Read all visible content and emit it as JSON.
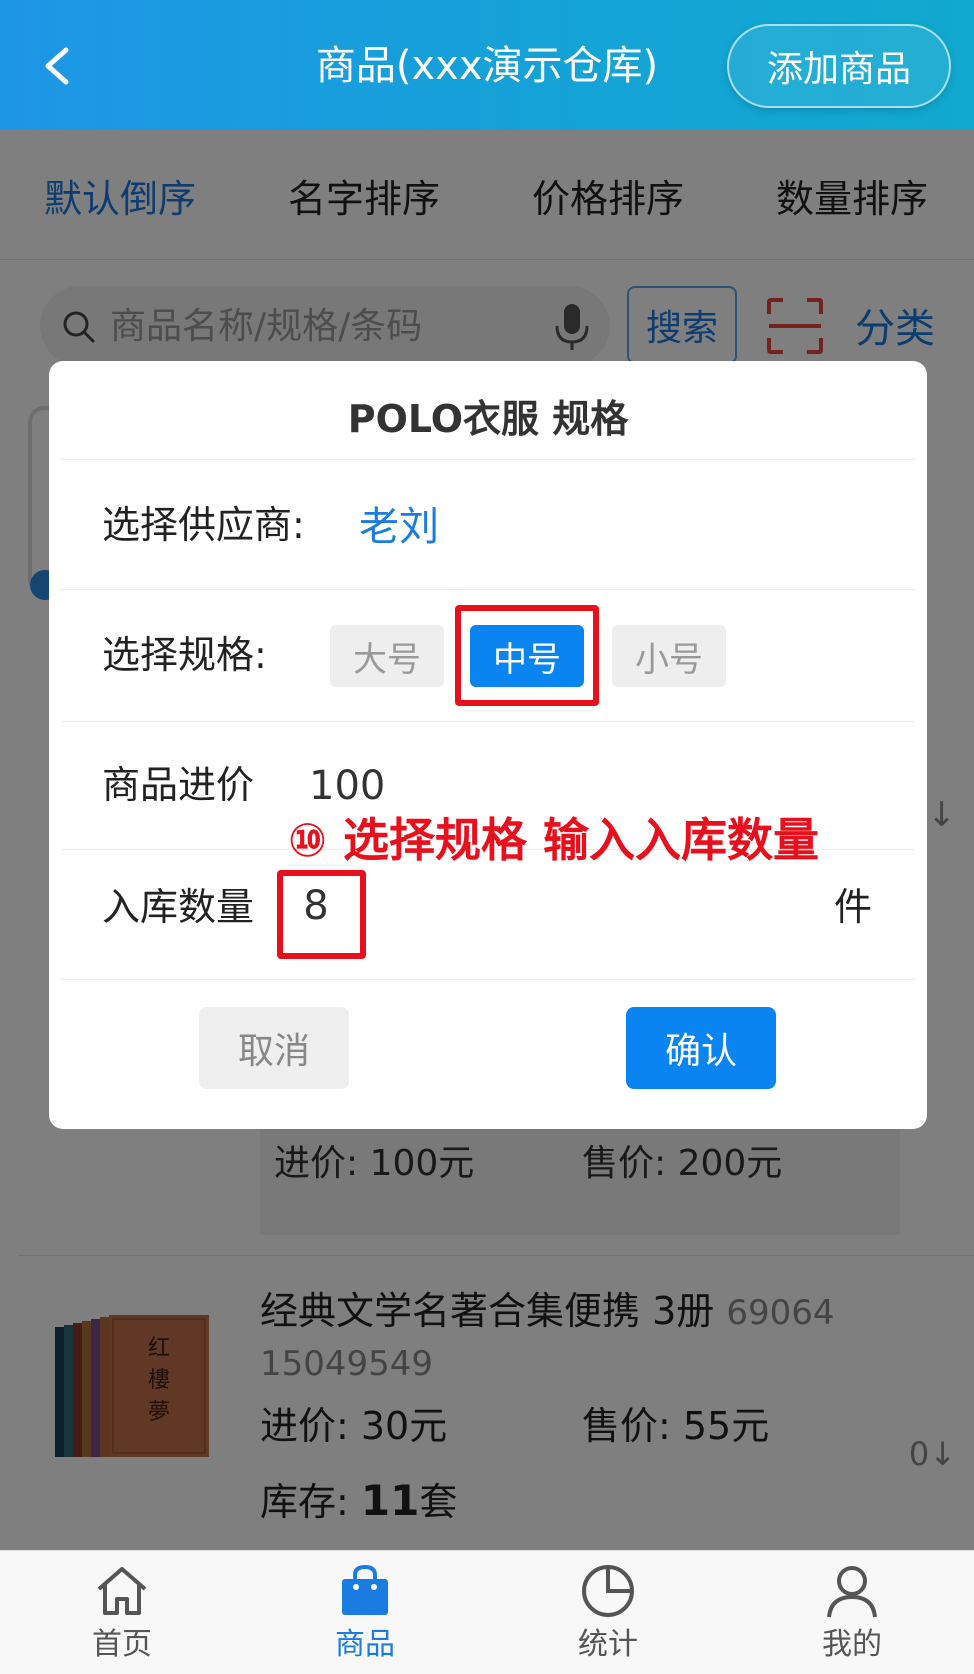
{
  "header": {
    "title": "商品(xxx演示仓库)",
    "add_button": "添加商品"
  },
  "sort_tabs": [
    {
      "label": "默认倒序",
      "active": true
    },
    {
      "label": "名字排序",
      "active": false
    },
    {
      "label": "价格排序",
      "active": false
    },
    {
      "label": "数量排序",
      "active": false
    }
  ],
  "search": {
    "placeholder": "商品名称/规格/条码",
    "button": "搜索",
    "category": "分类"
  },
  "list": {
    "partial_row": {
      "price_in": "进价: 100元",
      "price_out": "售价: 200元",
      "arrow": "↓"
    },
    "product": {
      "title": "经典文学名著合集便携   3册",
      "code_a": "69064",
      "code_b": "15049549",
      "price_in": "进价: 30元",
      "price_out": "售价: 55元",
      "stock_label": "库存: ",
      "stock_value": "11",
      "stock_unit": "套",
      "count": "0↓"
    }
  },
  "dialog": {
    "title": "POLO衣服  规格",
    "supplier_label": "选择供应商:",
    "supplier_value": "老刘",
    "spec_label": "选择规格:",
    "specs": [
      {
        "label": "大号",
        "selected": false
      },
      {
        "label": "中号",
        "selected": true
      },
      {
        "label": "小号",
        "selected": false
      }
    ],
    "price_label": "商品进价",
    "price_value": "100",
    "qty_label": "入库数量",
    "qty_value": "8",
    "qty_unit": "件",
    "cancel": "取消",
    "confirm": "确认"
  },
  "annotation": "⑩ 选择规格 输入入库数量",
  "bottom_nav": [
    {
      "label": "首页",
      "icon": "home-icon",
      "active": false
    },
    {
      "label": "商品",
      "icon": "shopping-bag-icon",
      "active": true
    },
    {
      "label": "统计",
      "icon": "pie-chart-icon",
      "active": false
    },
    {
      "label": "我的",
      "icon": "user-icon",
      "active": false
    }
  ],
  "colors": {
    "accent": "#0a84f0",
    "header": "#1596e0",
    "annotation": "#e8101c"
  }
}
